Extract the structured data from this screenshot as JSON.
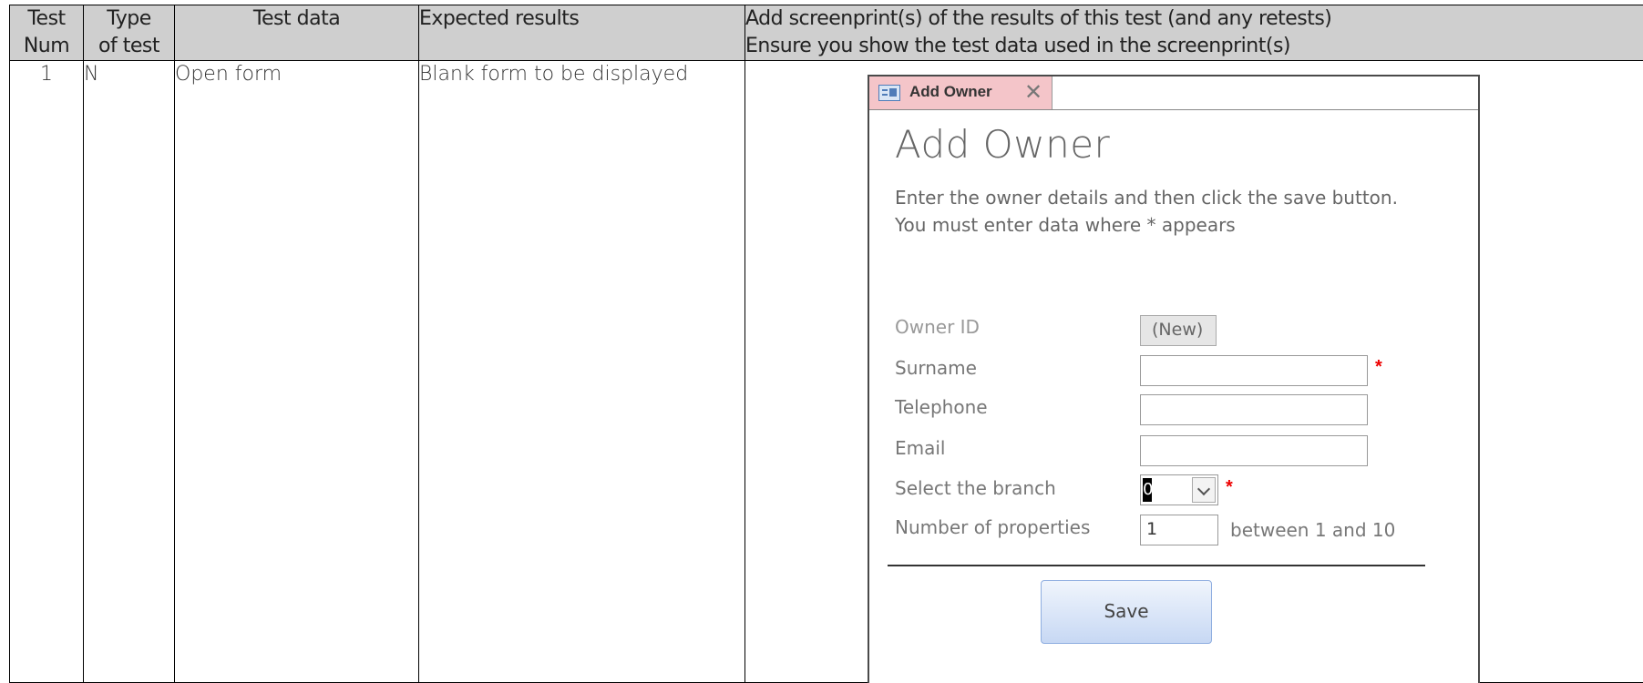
{
  "table": {
    "headers": {
      "test_num": [
        "Test",
        "Num"
      ],
      "type": [
        "Type",
        "of test"
      ],
      "test_data": "Test data",
      "expected": "Expected results",
      "screenprint": [
        "Add screenprint(s) of the results of this test (and any retests)",
        "Ensure you show the test data used in the screenprint(s)"
      ]
    },
    "rows": [
      {
        "num": "1",
        "type": "N",
        "data": "Open form",
        "expected": "Blank form to be displayed"
      }
    ]
  },
  "form": {
    "tab_label": "Add Owner",
    "title": "Add Owner",
    "instructions": [
      "Enter the owner details and then click the save button.",
      "You must enter data where * appears"
    ],
    "fields": {
      "owner_id_label": "Owner ID",
      "owner_id_value": "(New)",
      "surname_label": "Surname",
      "telephone_label": "Telephone",
      "email_label": "Email",
      "branch_label": "Select the branch",
      "branch_value": "0",
      "properties_label": "Number of properties",
      "properties_value": "1",
      "properties_hint": "between 1 and 10"
    },
    "required_marker": "*",
    "save_label": "Save"
  },
  "colors": {
    "header_bg": "#cfcfcf",
    "tab_bg": "#f4c5c9",
    "required": "#e00000",
    "save_button": "#c7d8f4"
  }
}
